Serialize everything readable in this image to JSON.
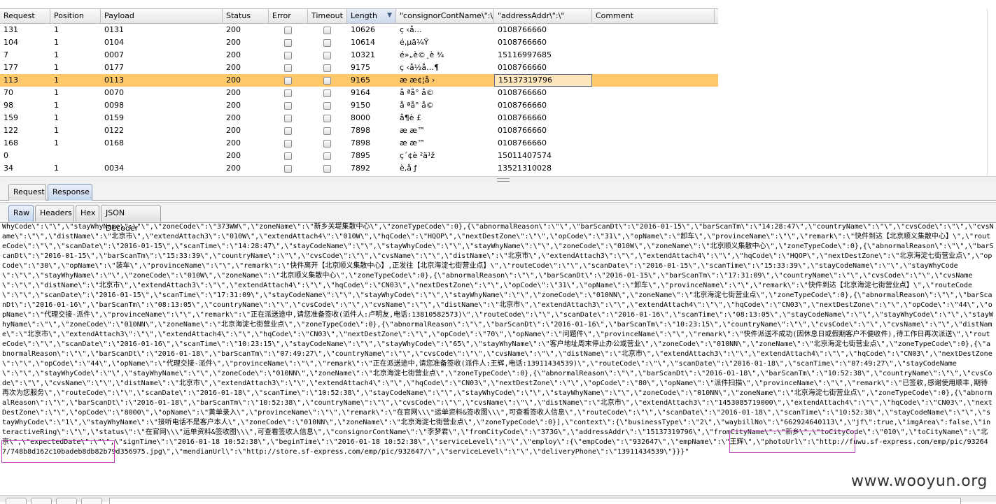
{
  "table": {
    "columns": [
      "Request",
      "Position",
      "Payload",
      "Status",
      "Error",
      "Timeout",
      "Length",
      "\"consignorContName\\\":\\\"",
      "\"addressAddr\\\":\\\"",
      "Comment"
    ],
    "sorted_column": "Length",
    "rows": [
      {
        "request": "131",
        "position": "1",
        "payload": "0131",
        "status": "200",
        "length": "10626",
        "consignor": "ç ‹å…",
        "address": "0108766660"
      },
      {
        "request": "104",
        "position": "1",
        "payload": "0104",
        "status": "200",
        "length": "10614",
        "consignor": "é‚µä¼Ÿ",
        "address": "0108766660"
      },
      {
        "request": "7",
        "position": "1",
        "payload": "0007",
        "status": "200",
        "length": "10321",
        "consignor": "é»„è©¸è ¾",
        "address": "15116997685"
      },
      {
        "request": "177",
        "position": "1",
        "payload": "0177",
        "status": "200",
        "length": "9175",
        "consignor": "ç ‹å½å…¶",
        "address": "0108766660"
      },
      {
        "request": "113",
        "position": "1",
        "payload": "0113",
        "status": "200",
        "length": "9165",
        "consignor": "æ   æ¢¦å ›",
        "address": "15137319796",
        "selected": true
      },
      {
        "request": "70",
        "position": "1",
        "payload": "0070",
        "status": "200",
        "length": "9164",
        "consignor": "å ªå° å©",
        "address": "0108766660"
      },
      {
        "request": "98",
        "position": "1",
        "payload": "0098",
        "status": "200",
        "length": "9150",
        "consignor": "å ªå° å©",
        "address": "0108766660"
      },
      {
        "request": "159",
        "position": "1",
        "payload": "0159",
        "status": "200",
        "length": "8000",
        "consignor": "å¶è £",
        "address": "0108766660"
      },
      {
        "request": "122",
        "position": "1",
        "payload": "0122",
        "status": "200",
        "length": "7898",
        "consignor": "æ   æ™",
        "address": "0108766660"
      },
      {
        "request": "168",
        "position": "1",
        "payload": "0168",
        "status": "200",
        "length": "7898",
        "consignor": "æ   æ™",
        "address": "0108766660"
      },
      {
        "request": "0",
        "position": "",
        "payload": "",
        "status": "200",
        "length": "7895",
        "consignor": "ç´¢è ²ä¹ž",
        "address": "15011407574"
      },
      {
        "request": "34",
        "position": "1",
        "payload": "0034",
        "status": "200",
        "length": "7892",
        "consignor": "è‚å ƒ",
        "address": "13521310028"
      }
    ]
  },
  "outer_tabs": [
    "Request",
    "Response"
  ],
  "inner_tabs": [
    "Raw",
    "Headers",
    "Hex",
    "JSON Decoder"
  ],
  "raw_response": "WhyCode\\\":\\\"\\\",\\\"stayWhyName\\\":\\\"\\\",\\\"zoneCode\\\":\\\"373WW\\\",\\\"zoneName\\\":\\\"新乡关堤集散中心\\\",\\\"zoneTypeCode\\\":0},{\\\"abnormalReason\\\":\\\"\\\",\\\"barScanDt\\\":\\\"2016-01-15\\\",\\\"barScanTm\\\":\\\"14:28:47\\\",\\\"countryName\\\":\\\"\\\",\\\"cvsCode\\\":\\\"\\\",\\\"cvsName\\\":\\\"\\\",\\\"distName\\\":\\\"北京市\\\",\\\"extendAttach3\\\":\\\"010W\\\",\\\"extendAttach4\\\":\\\"010W\\\",\\\"hqCode\\\":\\\"HQOP\\\",\\\"nextDestZone\\\":\\\"\\\",\\\"opCode\\\":\\\"31\\\",\\\"opName\\\":\\\"卸车\\\",\\\"provinceName\\\":\\\"\\\",\\\"remark\\\":\\\"快件到达【北京顺义集散中心】\\\",\\\"routeCode\\\":\\\"\\\",\\\"scanDate\\\":\\\"2016-01-15\\\",\\\"scanTime\\\":\\\"14:28:47\\\",\\\"stayCodeName\\\":\\\"\\\",\\\"stayWhyCode\\\":\\\"\\\",\\\"stayWhyName\\\":\\\"\\\",\\\"zoneCode\\\":\\\"010W\\\",\\\"zoneName\\\":\\\"北京顺义集散中心\\\",\\\"zoneTypeCode\\\":0},{\\\"abnormalReason\\\":\\\"\\\",\\\"barScanDt\\\":\\\"2016-01-15\\\",\\\"barScanTm\\\":\\\"15:33:39\\\",\\\"countryName\\\":\\\"\\\",\\\"cvsCode\\\":\\\"\\\",\\\"cvsName\\\":\\\"\\\",\\\"distName\\\":\\\"北京市\\\",\\\"extendAttach3\\\":\\\"\\\",\\\"extendAttach4\\\":\\\"\\\",\\\"hqCode\\\":\\\"HQOP\\\",\\\"nextDestZone\\\":\\\"北京海淀七街营业点\\\",\\\"opCode\\\":\\\"30\\\",\\\"opName\\\":\\\"装车\\\",\\\"provinceName\\\":\\\"\\\",\\\"remark\\\":\\\"快件离开【北京顺义集散中心】,正发往【北京海淀七街营业点】\\\",\\\"routeCode\\\":\\\"\\\",\\\"scanDate\\\":\\\"2016-01-15\\\",\\\"scanTime\\\":\\\"15:33:39\\\",\\\"stayCodeName\\\":\\\"\\\",\\\"stayWhyCode\\\":\\\"\\\",\\\"stayWhyName\\\":\\\"\\\",\\\"zoneCode\\\":\\\"010W\\\",\\\"zoneName\\\":\\\"北京顺义集散中心\\\",\\\"zoneTypeCode\\\":0},{\\\"abnormalReason\\\":\\\"\\\",\\\"barScanDt\\\":\\\"2016-01-15\\\",\\\"barScanTm\\\":\\\"17:31:09\\\",\\\"countryName\\\":\\\"\\\",\\\"cvsCode\\\":\\\"\\\",\\\"cvsName\\\":\\\"\\\",\\\"distName\\\":\\\"北京市\\\",\\\"extendAttach3\\\":\\\"\\\",\\\"extendAttach4\\\":\\\"\\\",\\\"hqCode\\\":\\\"CN03\\\",\\\"nextDestZone\\\":\\\"\\\",\\\"opCode\\\":\\\"31\\\",\\\"opName\\\":\\\"卸车\\\",\\\"provinceName\\\":\\\"\\\",\\\"remark\\\":\\\"快件到达【北京海淀七街营业点】\\\",\\\"routeCode\\\":\\\"\\\",\\\"scanDate\\\":\\\"2016-01-15\\\",\\\"scanTime\\\":\\\"17:31:09\\\",\\\"stayCodeName\\\":\\\"\\\",\\\"stayWhyCode\\\":\\\"\\\",\\\"stayWhyName\\\":\\\"\\\",\\\"zoneCode\\\":\\\"010NN\\\",\\\"zoneName\\\":\\\"北京海淀七街营业点\\\",\\\"zoneTypeCode\\\":0},{\\\"abnormalReason\\\":\\\"\\\",\\\"barScanDt\\\":\\\"2016-01-16\\\",\\\"barScanTm\\\":\\\"08:13:05\\\",\\\"countryName\\\":\\\"\\\",\\\"cvsCode\\\":\\\"\\\",\\\"cvsName\\\":\\\"\\\",\\\"distName\\\":\\\"北京市\\\",\\\"extendAttach3\\\":\\\"\\\",\\\"extendAttach4\\\":\\\"\\\",\\\"hqCode\\\":\\\"CN03\\\",\\\"nextDestZone\\\":\\\"\\\",\\\"opCode\\\":\\\"44\\\",\\\"opName\\\":\\\"代理交接-派件\\\",\\\"provinceName\\\":\\\"\\\",\\\"remark\\\":\\\"正在派送途中,请您准备签收(派件人:卢明友,电话:13810582573)\\\",\\\"routeCode\\\":\\\"\\\",\\\"scanDate\\\":\\\"2016-01-16\\\",\\\"scanTime\\\":\\\"08:13:05\\\",\\\"stayCodeName\\\":\\\"\\\",\\\"stayWhyCode\\\":\\\"\\\",\\\"stayWhyName\\\":\\\"\\\",\\\"zoneCode\\\":\\\"010NN\\\",\\\"zoneName\\\":\\\"北京海淀七街营业点\\\",\\\"zoneTypeCode\\\":0},{\\\"abnormalReason\\\":\\\"\\\",\\\"barScanDt\\\":\\\"2016-01-16\\\",\\\"barScanTm\\\":\\\"10:23:15\\\",\\\"countryName\\\":\\\"\\\",\\\"cvsCode\\\":\\\"\\\",\\\"cvsName\\\":\\\"\\\",\\\"distName\\\":\\\"北京市\\\",\\\"extendAttach3\\\":\\\"\\\",\\\"extendAttach4\\\":\\\"\\\",\\\"hqCode\\\":\\\"CN03\\\",\\\"nextDestZone\\\":\\\"\\\",\\\"opCode\\\":\\\"70\\\",\\\"opName\\\":\\\"问题件\\\",\\\"provinceName\\\":\\\"\\\",\\\"remark\\\":\\\"快件派送不成功(因休息日或假期客户不便收件),待工作日再次派送\\\",\\\"routeCode\\\":\\\"\\\",\\\"scanDate\\\":\\\"2016-01-16\\\",\\\"scanTime\\\":\\\"10:23:15\\\",\\\"stayCodeName\\\":\\\"\\\",\\\"stayWhyCode\\\":\\\"65\\\",\\\"stayWhyName\\\":\\\"客户地址周末停止办公或营业\\\",\\\"zoneCode\\\":\\\"010NN\\\",\\\"zoneName\\\":\\\"北京海淀七街营业点\\\",\\\"zoneTypeCode\\\":0},{\\\"abnormalReason\\\":\\\"\\\",\\\"barScanDt\\\":\\\"2016-01-18\\\",\\\"barScanTm\\\":\\\"07:49:27\\\",\\\"countryName\\\":\\\"\\\",\\\"cvsCode\\\":\\\"\\\",\\\"cvsName\\\":\\\"\\\",\\\"distName\\\":\\\"北京市\\\",\\\"extendAttach3\\\":\\\"\\\",\\\"extendAttach4\\\":\\\"\\\",\\\"hqCode\\\":\\\"CN03\\\",\\\"nextDestZone\\\":\\\"\\\",\\\"opCode\\\":\\\"44\\\",\\\"opName\\\":\\\"代理交接-派件\\\",\\\"provinceName\\\":\\\"\\\",\\\"remark\\\":\\\"正在派送途中,请您准备签收(派件人:王辉,电话:13911434539)\\\",\\\"routeCode\\\":\\\"\\\",\\\"scanDate\\\":\\\"2016-01-18\\\",\\\"scanTime\\\":\\\"07:49:27\\\",\\\"stayCodeName\\\":\\\"\\\",\\\"stayWhyCode\\\":\\\"\\\",\\\"stayWhyName\\\":\\\"\\\",\\\"zoneCode\\\":\\\"010NN\\\",\\\"zoneName\\\":\\\"北京海淀七街营业点\\\",\\\"zoneTypeCode\\\":0},{\\\"abnormalReason\\\":\\\"\\\",\\\"barScanDt\\\":\\\"2016-01-18\\\",\\\"barScanTm\\\":\\\"10:52:38\\\",\\\"countryName\\\":\\\"\\\",\\\"cvsCode\\\":\\\"\\\",\\\"cvsName\\\":\\\"\\\",\\\"distName\\\":\\\"北京市\\\",\\\"extendAttach3\\\":\\\"\\\",\\\"extendAttach4\\\":\\\"\\\",\\\"hqCode\\\":\\\"CN03\\\",\\\"nextDestZone\\\":\\\"\\\",\\\"opCode\\\":\\\"80\\\",\\\"opName\\\":\\\"派件扫描\\\",\\\"provinceName\\\":\\\"\\\",\\\"remark\\\":\\\"已签收,感谢使用顺丰,期待再次为您服务\\\",\\\"routeCode\\\":\\\"\\\",\\\"scanDate\\\":\\\"2016-01-18\\\",\\\"scanTime\\\":\\\"10:52:38\\\",\\\"stayCodeName\\\":\\\"\\\",\\\"stayWhyCode\\\":\\\"\\\",\\\"stayWhyName\\\":\\\"\\\",\\\"zoneCode\\\":\\\"010NN\\\",\\\"zoneName\\\":\\\"北京海淀七街营业点\\\",\\\"zoneTypeCode\\\":0},{\\\"abnormalReason\\\":\\\"\\\",\\\"barScanDt\\\":\\\"2016-01-18\\\",\\\"barScanTm\\\":\\\"10:52:38\\\",\\\"countryName\\\":\\\"\\\",\\\"cvsCode\\\":\\\"\\\",\\\"cvsName\\\":\\\"\\\",\\\"distName\\\":\\\"北京市\\\",\\\"extendAttach3\\\":\\\"1453085719000\\\",\\\"extendAttach4\\\":\\\"\\\",\\\"hqCode\\\":\\\"CN03\\\",\\\"nextDestZone\\\":\\\"\\\",\\\"opCode\\\":\\\"8000\\\",\\\"opName\\\":\\\"黄单录入\\\",\\\"provinceName\\\":\\\"\\\",\\\"remark\\\":\\\"在官网\\\\\\\"运单资料&签收图\\\\\\\",可查看签收人信息\\\",\\\"routeCode\\\":\\\"\\\",\\\"scanDate\\\":\\\"2016-01-18\\\",\\\"scanTime\\\":\\\"10:52:38\\\",\\\"stayCodeName\\\":\\\"\\\",\\\"stayWhyCode\\\":\\\"1\\\",\\\"stayWhyName\\\":\\\"接听电话不是客户本人\\\",\\\"zoneCode\\\":\\\"010NN\\\",\\\"zoneName\\\":\\\"北京海淀七街营业点\\\",\\\"zoneTypeCode\\\":0}],\\\"context\\\":{\\\"businessType\\\":\\\"2\\\",\\\"waybillNo\\\":\\\"662924640113\\\",\\\"jf\\\":true,\\\"imgArea\\\":false,\\\"interactiveRing\\\":\\\"\\\",\\\"status\\\":\\\"在官网\\\\\\\"运单资料&签收图\\\\\\\",可查看签收人信息\\\",\\\"consignorContName\\\":\\\"李梦君\\\",\\\"fromCityCode\\\":\\\"373G\\\",\\\"addressAddr\\\":\\\"15137319796\\\",\\\"fromCityName\\\":\\\"新乡\\\",\\\"toCityCode\\\":\\\"010\\\",\\\"toCityName\\\":\\\"北京\\\",\\\"expectedDate\\\":\\\"\\\",\\\"signTime\\\":\\\"2016-01-18 10:52:38\\\",\\\"beginTime\\\":\\\"2016-01-18 10:52:38\\\",\\\"serviceLevel\\\":\\\"\\\",\\\"employ\\\":{\\\"empCode\\\":\\\"932647\\\",\\\"empName\\\":\\\"王辉\\\",\\\"photoUrl\\\":\\\"http://fuwu.sf-express.com/emp/pic/932647/748b8d162c10badeb8db82b79d356975.jpg\\\",\\\"mendianUrl\\\":\\\"http://store.sf-express.com/emp/pic/932647/\\\",\\\"serviceLevel\\\":\\\"\\\",\\\"deliveryPhone\\\":\\\"13911434539\\\"}}}\"",
  "watermark": "www.wooyun.org"
}
